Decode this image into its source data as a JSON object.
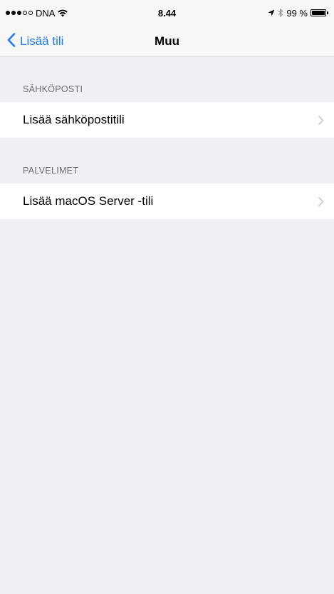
{
  "status_bar": {
    "carrier": "DNA",
    "time": "8.44",
    "battery_text": "99 %",
    "battery_level": 0.99,
    "signal_bars_filled": 3,
    "signal_bars_total": 5,
    "icons": [
      "wifi-icon",
      "location-icon",
      "bluetooth-icon",
      "battery-icon"
    ]
  },
  "nav": {
    "back_label": "Lisää tili",
    "title": "Muu",
    "tint_color": "#1a7cf5"
  },
  "sections": [
    {
      "header": "SÄHKÖPOSTI",
      "items": [
        {
          "label": "Lisää sähköpostitili"
        }
      ]
    },
    {
      "header": "PALVELIMET",
      "items": [
        {
          "label": "Lisää macOS Server -tili"
        }
      ]
    }
  ],
  "colors": {
    "background": "#efeff4",
    "cell": "#ffffff",
    "section_header": "#6d6d72",
    "chevron": "#c7c7cc"
  }
}
